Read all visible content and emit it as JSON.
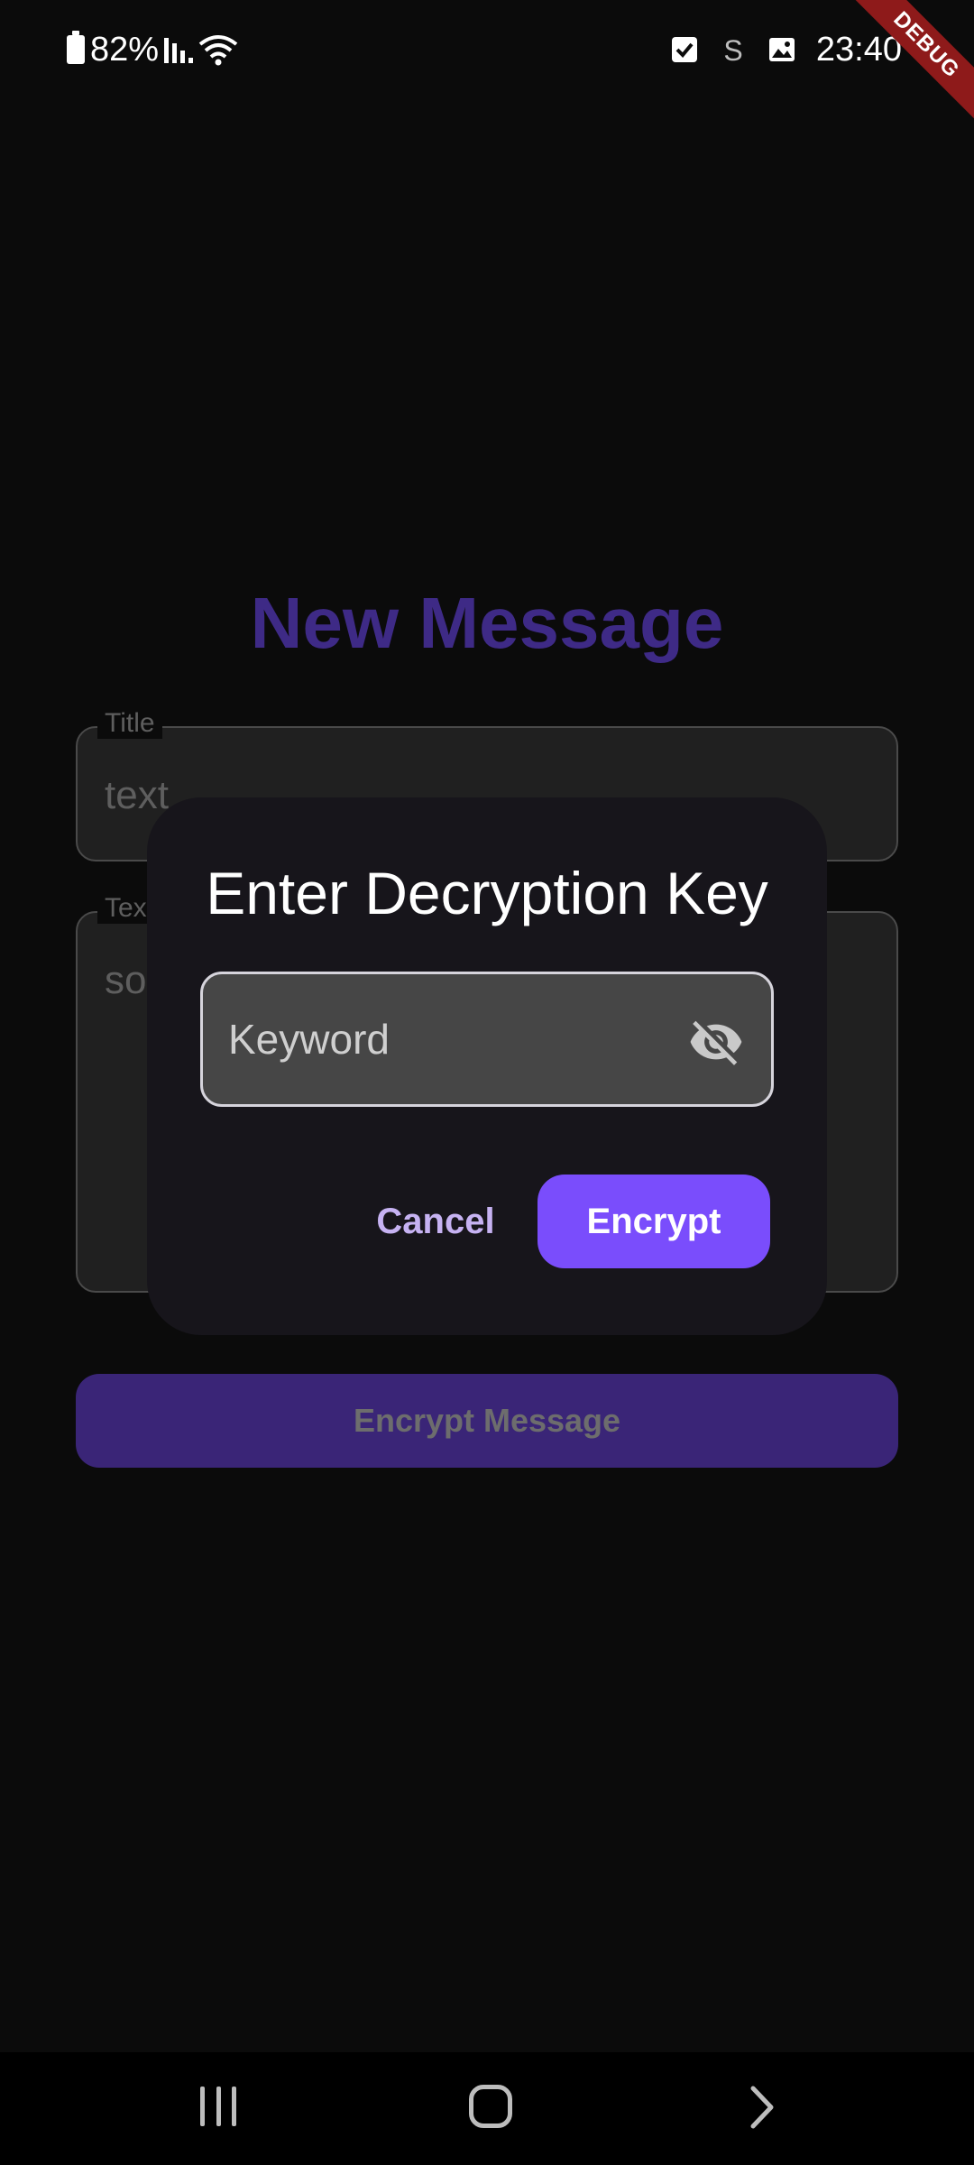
{
  "status_bar": {
    "battery_percent": "82%",
    "time": "23:40",
    "icons": [
      "battery-icon",
      "signal-icon",
      "wifi-icon",
      "checkbox-notification-icon",
      "s-notification-icon",
      "image-notification-icon"
    ]
  },
  "debug_banner": "DEBUG",
  "page": {
    "title": "New Message",
    "title_field": {
      "label": "Title",
      "value": "text"
    },
    "text_field": {
      "label": "Text",
      "value": "so"
    },
    "primary_button": "Encrypt Message"
  },
  "dialog": {
    "title": "Enter Decryption Key",
    "input_placeholder": "Keyword",
    "visibility_icon": "visibility-off-icon",
    "cancel_label": "Cancel",
    "confirm_label": "Encrypt"
  },
  "colors": {
    "accent": "#7a4dfc",
    "title_purple": "#3e2a86",
    "dialog_bg": "#17151b",
    "cancel_text": "#c6b2f2",
    "debug_red": "#8e1a1a"
  },
  "nav_bar": {
    "buttons": [
      "recent-apps-icon",
      "home-icon",
      "back-icon"
    ]
  }
}
